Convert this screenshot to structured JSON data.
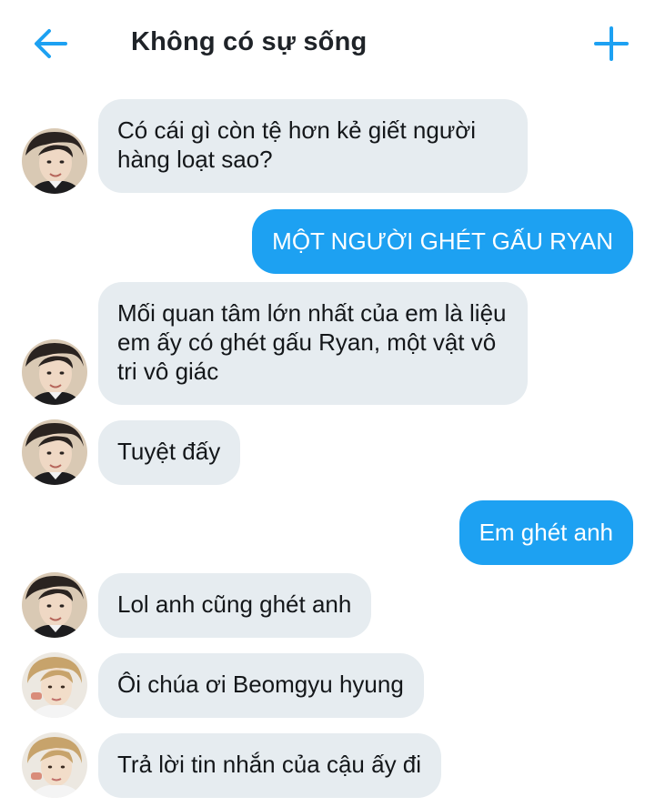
{
  "header": {
    "title": "Không có sự sống",
    "back_icon": "arrow-left-icon",
    "add_icon": "plus-icon",
    "accent_color": "#1da1f2"
  },
  "messages": [
    {
      "direction": "incoming",
      "avatar": "avatar-boy",
      "text": "Có cái gì còn tệ hơn kẻ giết người hàng loạt sao?"
    },
    {
      "direction": "outgoing",
      "text": "MỘT NGƯỜI GHÉT GẤU RYAN"
    },
    {
      "direction": "incoming",
      "avatar": "avatar-boy",
      "text": "Mối quan tâm lớn nhất của em là liệu em ấy có ghét gấu Ryan, một vật vô tri vô giác"
    },
    {
      "direction": "incoming",
      "avatar": "avatar-boy",
      "text": "Tuyệt đấy"
    },
    {
      "direction": "outgoing",
      "text": "Em ghét anh"
    },
    {
      "direction": "incoming",
      "avatar": "avatar-boy",
      "text": "Lol anh cũng ghét anh"
    },
    {
      "direction": "incoming",
      "avatar": "avatar-blond",
      "text": "Ôi chúa ơi Beomgyu hyung"
    },
    {
      "direction": "incoming",
      "avatar": "avatar-blond",
      "text": "Trả lời tin nhắn của cậu ấy đi"
    }
  ],
  "colors": {
    "incoming_bubble": "#e6ecf0",
    "outgoing_bubble": "#1da1f2"
  }
}
